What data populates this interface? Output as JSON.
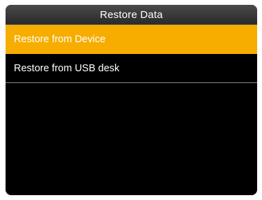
{
  "header": {
    "title": "Restore Data"
  },
  "menu": {
    "items": [
      {
        "label": "Restore from Device",
        "selected": true
      },
      {
        "label": "Restore from USB desk",
        "selected": false
      }
    ]
  },
  "colors": {
    "highlight": "#f6ad00",
    "background": "#000000",
    "text": "#ffffff"
  }
}
